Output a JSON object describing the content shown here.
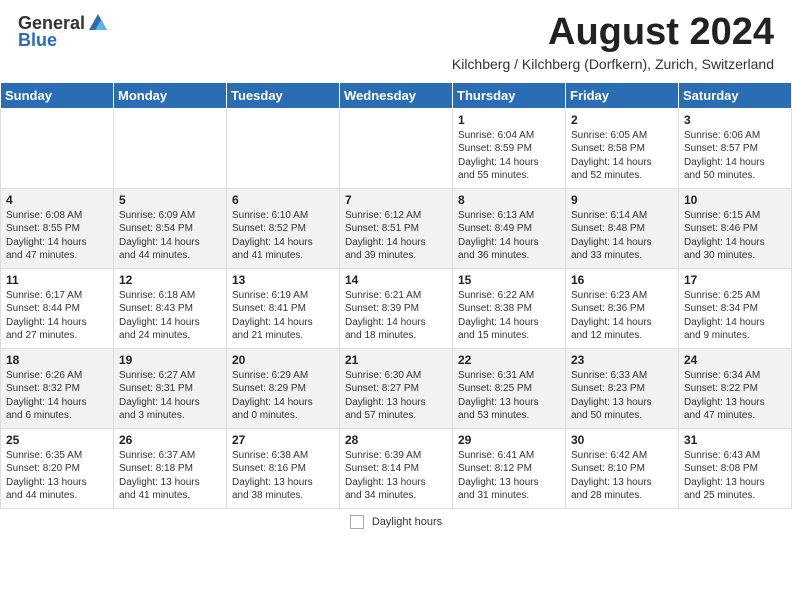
{
  "header": {
    "logo_general": "General",
    "logo_blue": "Blue",
    "month_year": "August 2024",
    "location": "Kilchberg / Kilchberg (Dorfkern), Zurich, Switzerland"
  },
  "calendar": {
    "days_of_week": [
      "Sunday",
      "Monday",
      "Tuesday",
      "Wednesday",
      "Thursday",
      "Friday",
      "Saturday"
    ],
    "weeks": [
      [
        {
          "day": "",
          "info": ""
        },
        {
          "day": "",
          "info": ""
        },
        {
          "day": "",
          "info": ""
        },
        {
          "day": "",
          "info": ""
        },
        {
          "day": "1",
          "info": "Sunrise: 6:04 AM\nSunset: 8:59 PM\nDaylight: 14 hours\nand 55 minutes."
        },
        {
          "day": "2",
          "info": "Sunrise: 6:05 AM\nSunset: 8:58 PM\nDaylight: 14 hours\nand 52 minutes."
        },
        {
          "day": "3",
          "info": "Sunrise: 6:06 AM\nSunset: 8:57 PM\nDaylight: 14 hours\nand 50 minutes."
        }
      ],
      [
        {
          "day": "4",
          "info": "Sunrise: 6:08 AM\nSunset: 8:55 PM\nDaylight: 14 hours\nand 47 minutes."
        },
        {
          "day": "5",
          "info": "Sunrise: 6:09 AM\nSunset: 8:54 PM\nDaylight: 14 hours\nand 44 minutes."
        },
        {
          "day": "6",
          "info": "Sunrise: 6:10 AM\nSunset: 8:52 PM\nDaylight: 14 hours\nand 41 minutes."
        },
        {
          "day": "7",
          "info": "Sunrise: 6:12 AM\nSunset: 8:51 PM\nDaylight: 14 hours\nand 39 minutes."
        },
        {
          "day": "8",
          "info": "Sunrise: 6:13 AM\nSunset: 8:49 PM\nDaylight: 14 hours\nand 36 minutes."
        },
        {
          "day": "9",
          "info": "Sunrise: 6:14 AM\nSunset: 8:48 PM\nDaylight: 14 hours\nand 33 minutes."
        },
        {
          "day": "10",
          "info": "Sunrise: 6:15 AM\nSunset: 8:46 PM\nDaylight: 14 hours\nand 30 minutes."
        }
      ],
      [
        {
          "day": "11",
          "info": "Sunrise: 6:17 AM\nSunset: 8:44 PM\nDaylight: 14 hours\nand 27 minutes."
        },
        {
          "day": "12",
          "info": "Sunrise: 6:18 AM\nSunset: 8:43 PM\nDaylight: 14 hours\nand 24 minutes."
        },
        {
          "day": "13",
          "info": "Sunrise: 6:19 AM\nSunset: 8:41 PM\nDaylight: 14 hours\nand 21 minutes."
        },
        {
          "day": "14",
          "info": "Sunrise: 6:21 AM\nSunset: 8:39 PM\nDaylight: 14 hours\nand 18 minutes."
        },
        {
          "day": "15",
          "info": "Sunrise: 6:22 AM\nSunset: 8:38 PM\nDaylight: 14 hours\nand 15 minutes."
        },
        {
          "day": "16",
          "info": "Sunrise: 6:23 AM\nSunset: 8:36 PM\nDaylight: 14 hours\nand 12 minutes."
        },
        {
          "day": "17",
          "info": "Sunrise: 6:25 AM\nSunset: 8:34 PM\nDaylight: 14 hours\nand 9 minutes."
        }
      ],
      [
        {
          "day": "18",
          "info": "Sunrise: 6:26 AM\nSunset: 8:32 PM\nDaylight: 14 hours\nand 6 minutes."
        },
        {
          "day": "19",
          "info": "Sunrise: 6:27 AM\nSunset: 8:31 PM\nDaylight: 14 hours\nand 3 minutes."
        },
        {
          "day": "20",
          "info": "Sunrise: 6:29 AM\nSunset: 8:29 PM\nDaylight: 14 hours\nand 0 minutes."
        },
        {
          "day": "21",
          "info": "Sunrise: 6:30 AM\nSunset: 8:27 PM\nDaylight: 13 hours\nand 57 minutes."
        },
        {
          "day": "22",
          "info": "Sunrise: 6:31 AM\nSunset: 8:25 PM\nDaylight: 13 hours\nand 53 minutes."
        },
        {
          "day": "23",
          "info": "Sunrise: 6:33 AM\nSunset: 8:23 PM\nDaylight: 13 hours\nand 50 minutes."
        },
        {
          "day": "24",
          "info": "Sunrise: 6:34 AM\nSunset: 8:22 PM\nDaylight: 13 hours\nand 47 minutes."
        }
      ],
      [
        {
          "day": "25",
          "info": "Sunrise: 6:35 AM\nSunset: 8:20 PM\nDaylight: 13 hours\nand 44 minutes."
        },
        {
          "day": "26",
          "info": "Sunrise: 6:37 AM\nSunset: 8:18 PM\nDaylight: 13 hours\nand 41 minutes."
        },
        {
          "day": "27",
          "info": "Sunrise: 6:38 AM\nSunset: 8:16 PM\nDaylight: 13 hours\nand 38 minutes."
        },
        {
          "day": "28",
          "info": "Sunrise: 6:39 AM\nSunset: 8:14 PM\nDaylight: 13 hours\nand 34 minutes."
        },
        {
          "day": "29",
          "info": "Sunrise: 6:41 AM\nSunset: 8:12 PM\nDaylight: 13 hours\nand 31 minutes."
        },
        {
          "day": "30",
          "info": "Sunrise: 6:42 AM\nSunset: 8:10 PM\nDaylight: 13 hours\nand 28 minutes."
        },
        {
          "day": "31",
          "info": "Sunrise: 6:43 AM\nSunset: 8:08 PM\nDaylight: 13 hours\nand 25 minutes."
        }
      ]
    ]
  },
  "footer": {
    "daylight_label": "Daylight hours"
  }
}
